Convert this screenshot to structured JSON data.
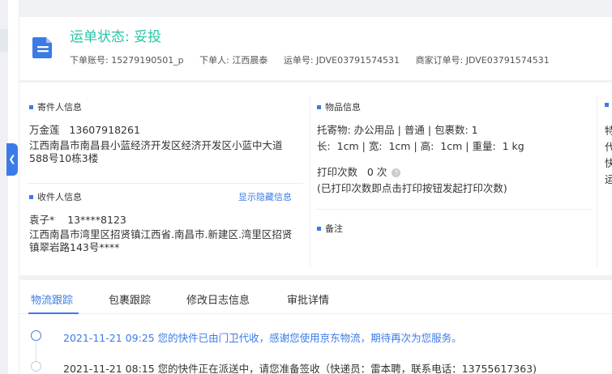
{
  "header": {
    "status": "运单状态: 妥投",
    "order_account": "下单账号: 15279190501_p",
    "orderer": "下单人: 江西晨泰",
    "waybill_no": "运单号: JDVE03791574531",
    "merchant_order_no": "商家订单号: JDVE03791574531"
  },
  "sender": {
    "section_title": "寄件人信息",
    "name_phone": "万金莲   13607918261",
    "address": "江西南昌市南昌县小蓝经济开发区经济开发区小蓝中大道588号10栋3楼"
  },
  "receiver": {
    "section_title": "收件人信息",
    "toggle_label": "显示隐藏信息",
    "name_phone": "袁子*    13****8123",
    "address": "江西南昌市湾里区招贤镇江西省.南昌市.新建区.湾里区招贤镇翠岩路143号****"
  },
  "goods": {
    "section_title": "物品信息",
    "line1": "托寄物: 办公用品 | 普通 | 包裹数: 1",
    "line2": "长:  1cm | 宽:  1cm | 高:  1cm | 重量:  1 kg",
    "print_count": "打印次数   0 次",
    "print_note": "(已打印次数即点击打印按钮发起打印次数)"
  },
  "remark": {
    "section_title": "备注"
  },
  "clipped_column": {
    "lines": [
      "特",
      "代",
      "快",
      "运"
    ]
  },
  "tabs": [
    {
      "label": "物流跟踪"
    },
    {
      "label": "包裹跟踪"
    },
    {
      "label": "修改日志信息"
    },
    {
      "label": "审批详情"
    }
  ],
  "timeline": [
    {
      "text": "2021-11-21 09:25 您的快件已由门卫代收，感谢您使用京东物流，期待再次为您服务。",
      "color": "#3b7be8"
    },
    {
      "text": "2021-11-21 08:15 您的快件正在派送中，请您准备签收（快递员：雷本聘，联系电话：13755617363)",
      "color": "#333333"
    }
  ],
  "colors": {
    "accent": "#3b7be8",
    "status_green": "#28c4a8"
  }
}
